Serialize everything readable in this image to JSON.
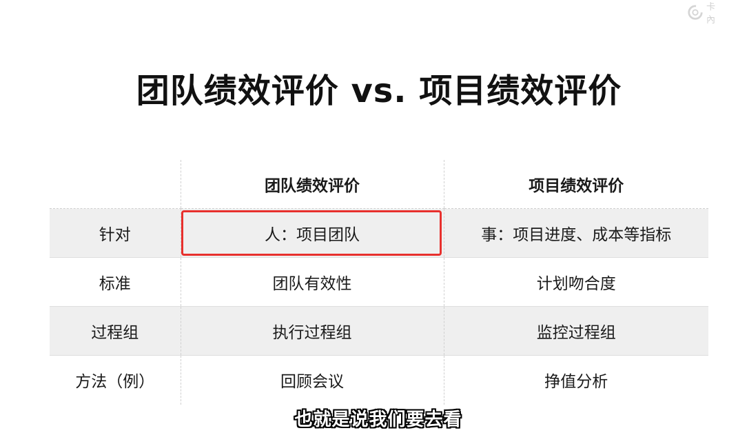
{
  "logo": {
    "text": "卡內"
  },
  "title": "团队绩效评价 vs. 项目绩效评价",
  "table": {
    "headers": [
      "",
      "团队绩效评价",
      "项目绩效评价"
    ],
    "rows": [
      [
        "针对",
        "人：项目团队",
        "事：项目进度、成本等指标"
      ],
      [
        "标准",
        "团队有效性",
        "计划吻合度"
      ],
      [
        "过程组",
        "执行过程组",
        "监控过程组"
      ],
      [
        "方法（例）",
        "回顾会议",
        "挣值分析"
      ]
    ]
  },
  "highlight_color": "#e8302d",
  "subtitle": "也就是说我们要去看"
}
